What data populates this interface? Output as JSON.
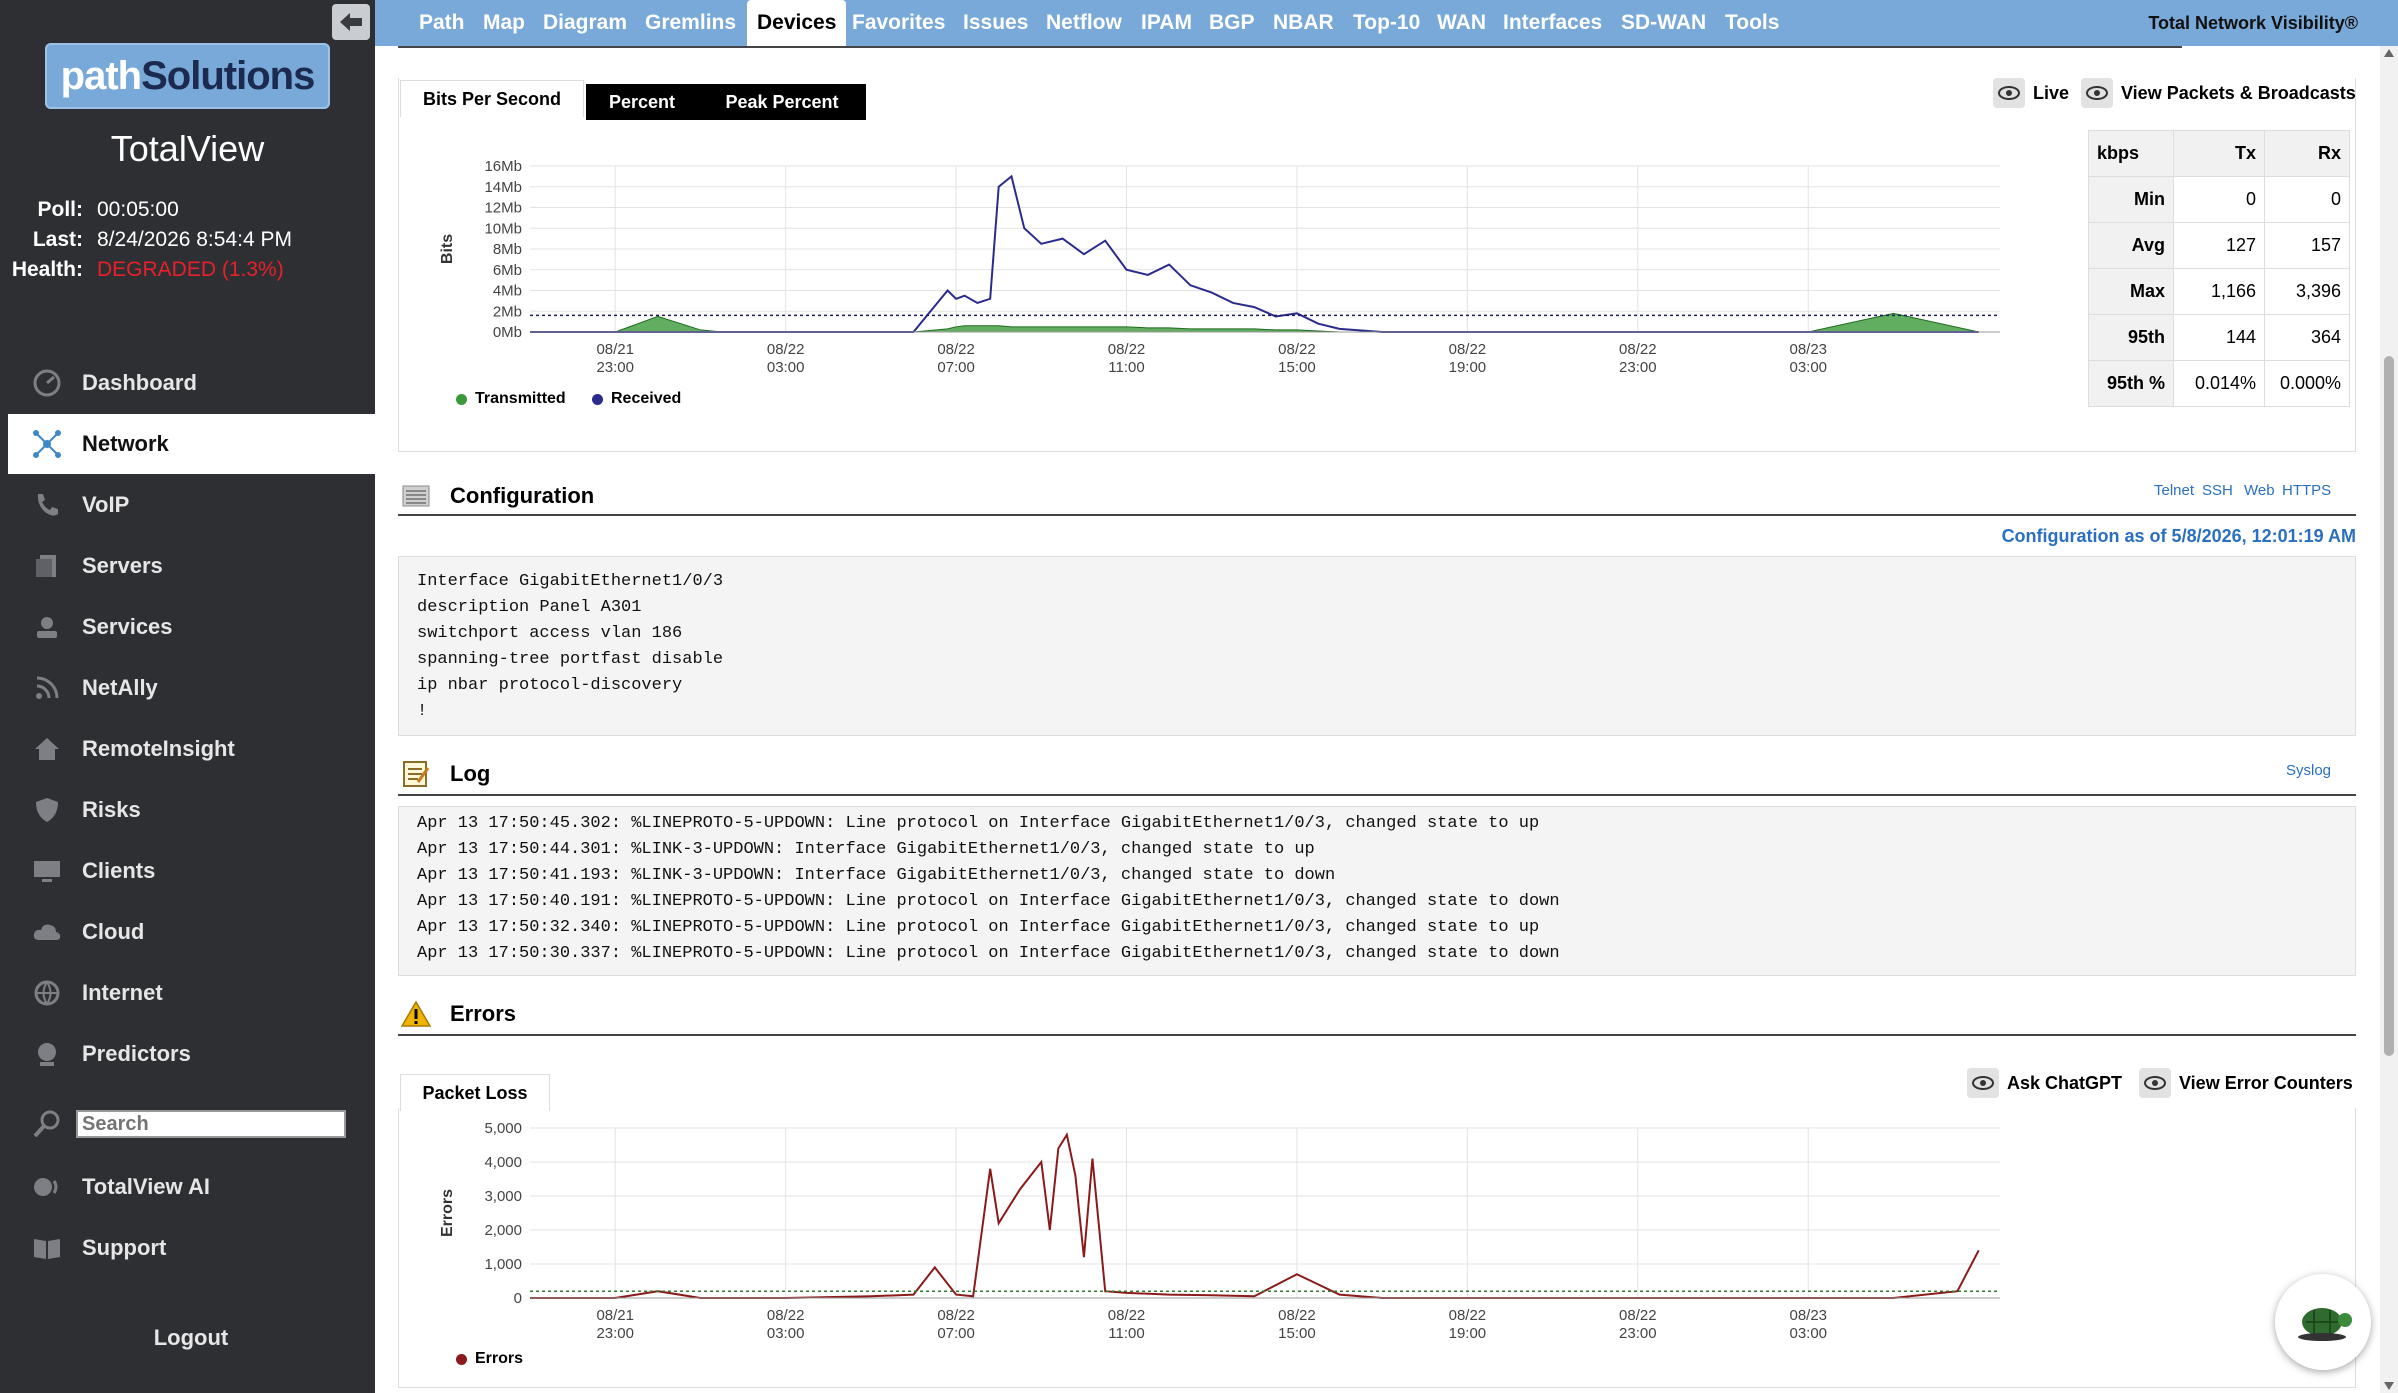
{
  "sidebar": {
    "brand_a": "path",
    "brand_b": "Solutions",
    "product": "TotalView",
    "stats": [
      {
        "key": "Poll:",
        "value": "00:05:00"
      },
      {
        "key": "Last:",
        "value": "8/24/2026 8:54:4 PM"
      },
      {
        "key": "Health:",
        "value": "DEGRADED (1.3%)"
      }
    ],
    "items": [
      {
        "label": "Dashboard",
        "icon": "dashboard-icon"
      },
      {
        "label": "Network",
        "icon": "network-icon"
      },
      {
        "label": "VoIP",
        "icon": "phone-icon"
      },
      {
        "label": "Servers",
        "icon": "servers-icon"
      },
      {
        "label": "Services",
        "icon": "services-icon"
      },
      {
        "label": "NetAlly",
        "icon": "rss-icon"
      },
      {
        "label": "RemoteInsight",
        "icon": "home-icon"
      },
      {
        "label": "Risks",
        "icon": "shield-icon"
      },
      {
        "label": "Clients",
        "icon": "monitor-icon"
      },
      {
        "label": "Cloud",
        "icon": "cloud-icon"
      },
      {
        "label": "Internet",
        "icon": "globe-icon"
      },
      {
        "label": "Predictors",
        "icon": "crystal-ball-icon"
      }
    ],
    "search_placeholder": "Search",
    "items2": [
      {
        "label": "TotalView AI",
        "icon": "ai-icon"
      },
      {
        "label": "Support",
        "icon": "book-icon"
      }
    ],
    "logout": "Logout"
  },
  "topnav": {
    "items": [
      "Path",
      "Map",
      "Diagram",
      "Gremlins",
      "Devices",
      "Favorites",
      "Issues",
      "Netflow",
      "IPAM",
      "BGP",
      "NBAR",
      "Top-10",
      "WAN",
      "Interfaces",
      "SD-WAN",
      "Tools"
    ],
    "active": "Devices",
    "tagline": "Total Network Visibility®"
  },
  "bandwidth": {
    "tabs": [
      "Bits Per Second",
      "Percent",
      "Peak Percent"
    ],
    "live_label": "Live",
    "packets_label": "View Packets & Broadcasts",
    "legend": [
      "Transmitted",
      "Received"
    ],
    "table": {
      "header": [
        "kbps",
        "Tx",
        "Rx"
      ],
      "rows": [
        [
          "Min",
          "0",
          "0"
        ],
        [
          "Avg",
          "127",
          "157"
        ],
        [
          "Max",
          "1,166",
          "3,396"
        ],
        [
          "95th",
          "144",
          "364"
        ],
        [
          "95th %",
          "0.014%",
          "0.000%"
        ]
      ]
    }
  },
  "configuration": {
    "title": "Configuration",
    "links": [
      "Telnet",
      "SSH",
      "Web",
      "HTTPS"
    ],
    "as_of": "Configuration as of 5/8/2026, 12:01:19 AM",
    "lines": [
      "Interface GigabitEthernet1/0/3",
      "description Panel A301",
      "switchport access vlan 186",
      "spanning-tree portfast disable",
      "ip nbar protocol-discovery",
      "!"
    ]
  },
  "log": {
    "title": "Log",
    "link": "Syslog",
    "lines": [
      "Apr 13 17:50:45.302: %LINEPROTO-5-UPDOWN: Line protocol on Interface GigabitEthernet1/0/3, changed state to up",
      "Apr 13 17:50:44.301: %LINK-3-UPDOWN: Interface GigabitEthernet1/0/3, changed state to up",
      "Apr 13 17:50:41.193: %LINK-3-UPDOWN: Interface GigabitEthernet1/0/3, changed state to down",
      "Apr 13 17:50:40.191: %LINEPROTO-5-UPDOWN: Line protocol on Interface GigabitEthernet1/0/3, changed state to down",
      "Apr 13 17:50:32.340: %LINEPROTO-5-UPDOWN: Line protocol on Interface GigabitEthernet1/0/3, changed state to up",
      "Apr 13 17:50:30.337: %LINEPROTO-5-UPDOWN: Line protocol on Interface GigabitEthernet1/0/3, changed state to down"
    ]
  },
  "errors": {
    "title": "Errors",
    "tab": "Packet Loss",
    "ask_label": "Ask ChatGPT",
    "counters_label": "View Error Counters",
    "legend": "Errors"
  },
  "colors": {
    "accent": "#78a9d8",
    "sidebar": "#2e2f33",
    "transmitted": "#3a9a3a",
    "received": "#2b2b8c",
    "errors": "#8b1a1a",
    "health_bad": "#e8202a"
  },
  "chart_data": [
    {
      "type": "area",
      "ylabel": "Bits",
      "ylim": [
        0,
        16
      ],
      "yticks": [
        "0Mb",
        "2Mb",
        "4Mb",
        "6Mb",
        "8Mb",
        "10Mb",
        "12Mb",
        "14Mb",
        "16Mb"
      ],
      "xticks": [
        [
          "08/21",
          "23:00"
        ],
        [
          "08/22",
          "03:00"
        ],
        [
          "08/22",
          "07:00"
        ],
        [
          "08/22",
          "11:00"
        ],
        [
          "08/22",
          "15:00"
        ],
        [
          "08/22",
          "19:00"
        ],
        [
          "08/22",
          "23:00"
        ],
        [
          "08/23",
          "03:00"
        ]
      ],
      "x_hours": [
        0,
        2,
        3,
        4,
        4.5,
        5,
        6,
        7,
        8,
        9,
        9.8,
        10,
        10.2,
        10.5,
        10.8,
        11,
        11.3,
        11.6,
        12,
        12.5,
        13,
        13.5,
        14,
        14.5,
        15,
        15.5,
        16,
        16.5,
        17,
        17.5,
        18,
        18.5,
        19,
        20,
        22,
        24,
        26,
        28,
        30,
        32,
        34
      ],
      "series": [
        {
          "name": "Transmitted",
          "values": [
            0,
            0,
            1.5,
            0.2,
            0,
            0,
            0,
            0,
            0,
            0,
            0.3,
            0.5,
            0.6,
            0.6,
            0.6,
            0.6,
            0.5,
            0.5,
            0.5,
            0.5,
            0.5,
            0.5,
            0.5,
            0.4,
            0.4,
            0.3,
            0.3,
            0.3,
            0.3,
            0.2,
            0.2,
            0.1,
            0,
            0,
            0,
            0,
            0,
            0,
            0,
            1.8,
            0
          ]
        },
        {
          "name": "Received",
          "values": [
            0,
            0,
            0,
            0,
            0,
            0,
            0,
            0,
            0,
            0,
            4,
            3.2,
            3.5,
            2.8,
            3.2,
            14,
            15,
            10,
            8.5,
            9,
            7.5,
            8.8,
            6,
            5.5,
            6.5,
            4.5,
            3.8,
            2.8,
            2.4,
            1.5,
            1.8,
            0.8,
            0.3,
            0,
            0,
            0,
            0,
            0,
            0,
            0,
            0
          ]
        }
      ],
      "reference_line": 1.6
    },
    {
      "type": "line",
      "ylabel": "Errors",
      "ylim": [
        0,
        5000
      ],
      "yticks": [
        "0",
        "1,000",
        "2,000",
        "3,000",
        "4,000",
        "5,000"
      ],
      "xticks": [
        [
          "08/21",
          "23:00"
        ],
        [
          "08/22",
          "03:00"
        ],
        [
          "08/22",
          "07:00"
        ],
        [
          "08/22",
          "11:00"
        ],
        [
          "08/22",
          "15:00"
        ],
        [
          "08/22",
          "19:00"
        ],
        [
          "08/22",
          "23:00"
        ],
        [
          "08/23",
          "03:00"
        ]
      ],
      "x_hours": [
        0,
        2,
        3,
        4,
        6,
        8,
        9,
        9.5,
        10,
        10.4,
        10.8,
        11,
        11.5,
        12,
        12.2,
        12.4,
        12.6,
        12.8,
        13,
        13.2,
        13.5,
        14,
        15,
        16,
        17,
        18,
        19,
        20,
        22,
        24,
        26,
        28,
        30,
        32,
        33.5,
        34
      ],
      "series": [
        {
          "name": "Errors",
          "values": [
            0,
            0,
            200,
            0,
            0,
            50,
            100,
            900,
            100,
            50,
            3800,
            2200,
            3200,
            4000,
            2000,
            4400,
            4800,
            3600,
            1200,
            4100,
            200,
            150,
            100,
            80,
            50,
            700,
            100,
            0,
            0,
            0,
            0,
            0,
            0,
            0,
            200,
            1400
          ]
        }
      ],
      "reference_line": 200
    }
  ]
}
